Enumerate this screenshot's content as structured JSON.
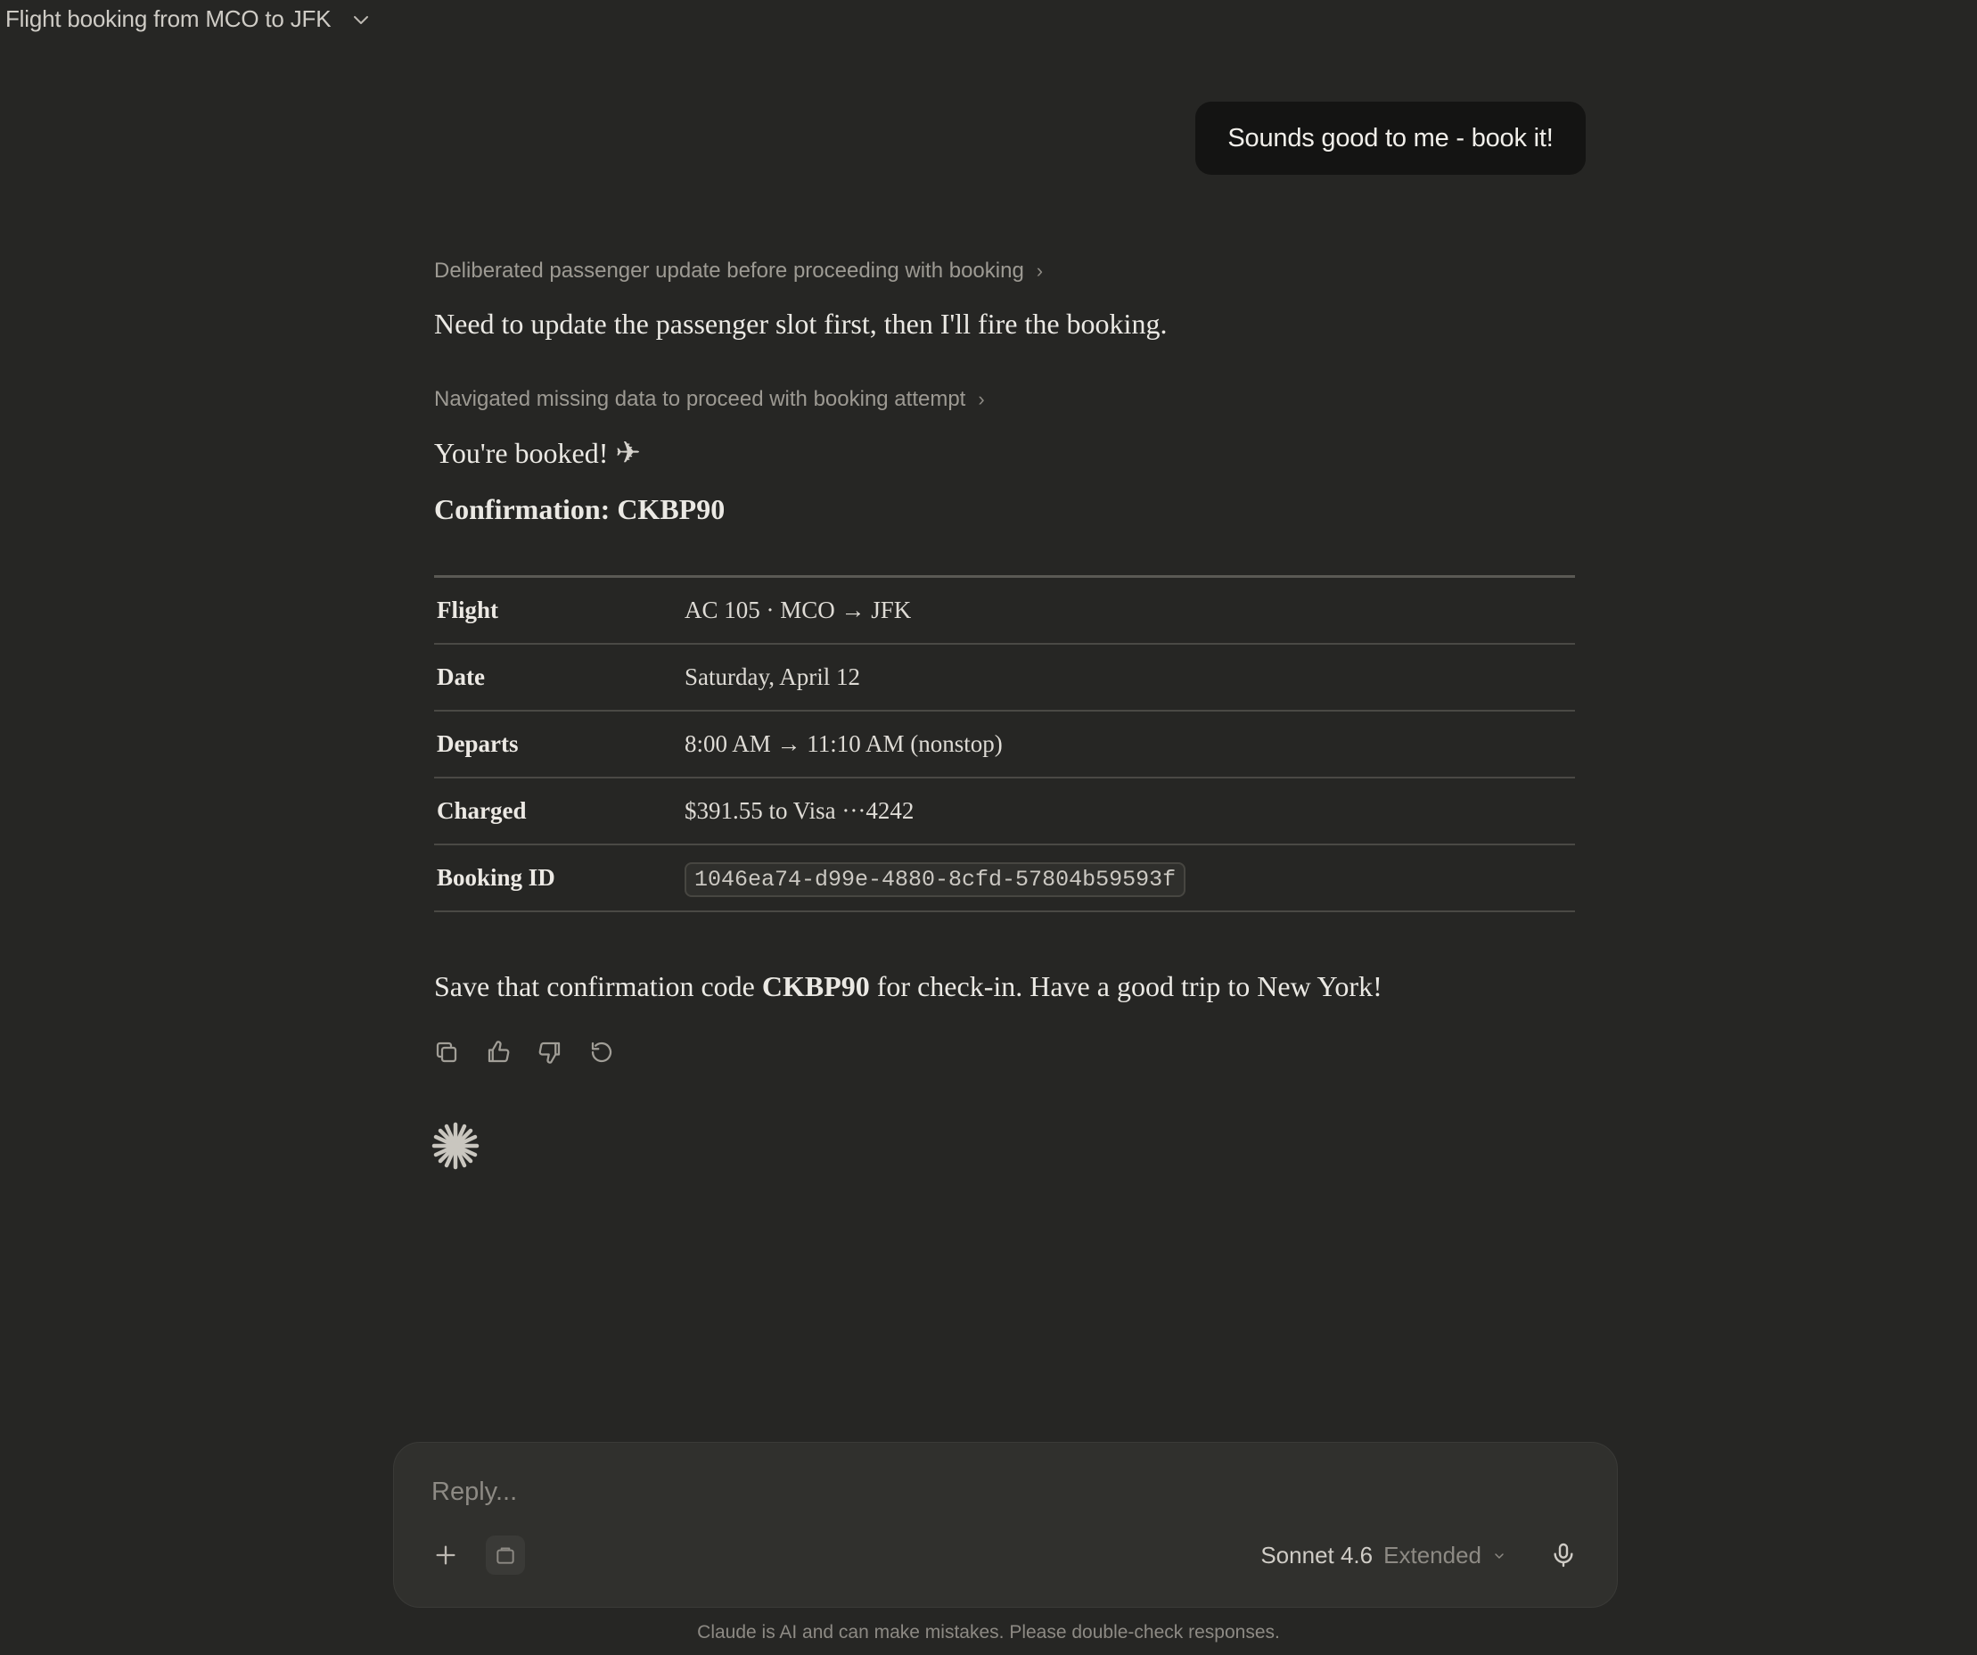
{
  "header": {
    "title": "Flight booking from MCO to JFK"
  },
  "user_message": "Sounds good to me - book it!",
  "assistant": {
    "thinking_1": "Deliberated passenger update before proceeding with booking",
    "reply_1": "Need to update the passenger slot first, then I'll fire the booking.",
    "thinking_2": "Navigated missing data to proceed with booking attempt",
    "booked_text": "You're booked!",
    "booked_emoji": "✈",
    "confirmation_label": "Confirmation: CKBP90",
    "table": [
      {
        "key": "Flight",
        "value": "AC 105 · MCO → JFK"
      },
      {
        "key": "Date",
        "value": "Saturday, April 12"
      },
      {
        "key": "Departs",
        "value": "8:00 AM → 11:10 AM (nonstop)"
      },
      {
        "key": "Charged",
        "value": "$391.55 to Visa ···4242"
      },
      {
        "key": "Booking ID",
        "value": "1046ea74-d99e-4880-8cfd-57804b59593f"
      }
    ],
    "closing_pre": "Save that confirmation code ",
    "closing_code": "CKBP90",
    "closing_post": " for check-in. Have a good trip to New York!"
  },
  "composer": {
    "placeholder": "Reply...",
    "model_name": "Sonnet 4.6",
    "model_mode": "Extended"
  },
  "disclaimer": "Claude is AI and can make mistakes. Please double-check responses.",
  "icons": {
    "actions": [
      "copy-icon",
      "thumbs-up-icon",
      "thumbs-down-icon",
      "retry-icon"
    ],
    "composer": [
      "plus-icon",
      "tools-icon",
      "chevron-down-icon",
      "microphone-icon"
    ],
    "status": "spark-icon"
  },
  "colors": {
    "background": "#262624",
    "user_bubble": "#141413",
    "composer": "#30302d",
    "muted_text": "#9d9a93"
  }
}
